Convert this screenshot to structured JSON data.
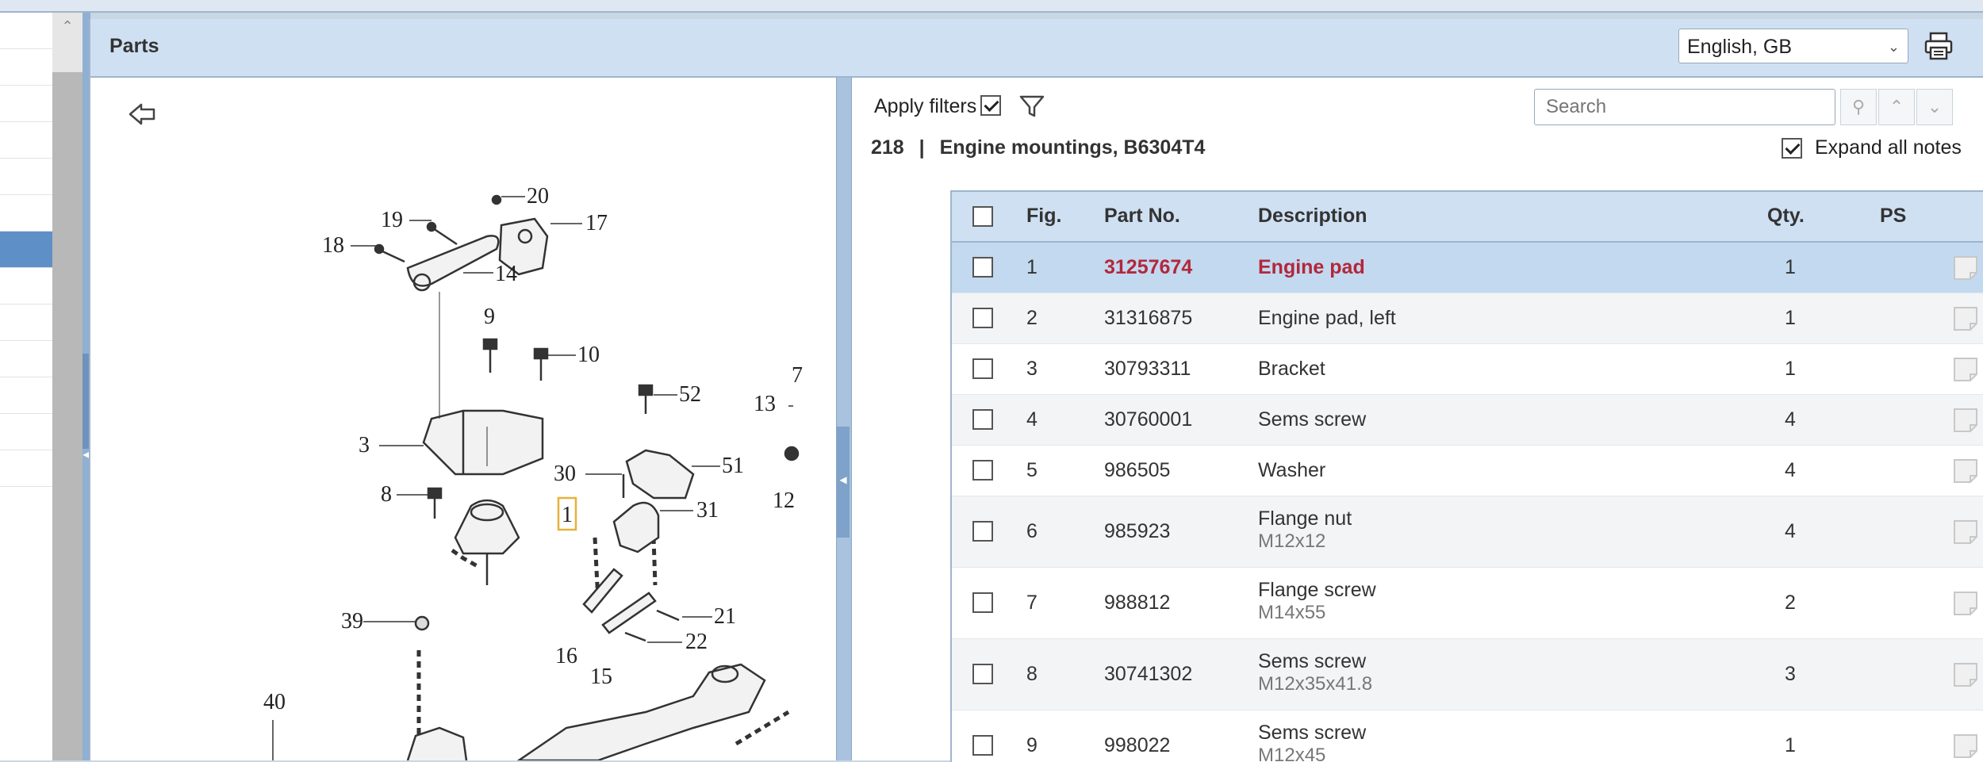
{
  "app": {
    "panel_title": "Parts",
    "language": "English, GB"
  },
  "illustration": {
    "callouts": [
      "20",
      "17",
      "19",
      "18",
      "14",
      "9",
      "10",
      "52",
      "13",
      "3",
      "51",
      "30",
      "8",
      "1",
      "31",
      "12",
      "39",
      "16",
      "15",
      "21",
      "22",
      "40",
      "7"
    ]
  },
  "filters": {
    "apply_label": "Apply filters",
    "apply_checked": true,
    "search_placeholder": "Search",
    "expand_label": "Expand all notes",
    "expand_checked": true
  },
  "breadcrumb": {
    "group": "218",
    "separator": "|",
    "title": "Engine mountings, B6304T4"
  },
  "table": {
    "columns": {
      "fig": "Fig.",
      "part_no": "Part No.",
      "description": "Description",
      "qty": "Qty.",
      "ps": "PS"
    },
    "rows": [
      {
        "fig": "1",
        "part_no": "31257674",
        "description": "Engine pad",
        "sub": "",
        "qty": "1",
        "selected": true
      },
      {
        "fig": "2",
        "part_no": "31316875",
        "description": "Engine pad, left",
        "sub": "",
        "qty": "1"
      },
      {
        "fig": "3",
        "part_no": "30793311",
        "description": "Bracket",
        "sub": "",
        "qty": "1"
      },
      {
        "fig": "4",
        "part_no": "30760001",
        "description": "Sems screw",
        "sub": "",
        "qty": "4"
      },
      {
        "fig": "5",
        "part_no": "986505",
        "description": "Washer",
        "sub": "",
        "qty": "4"
      },
      {
        "fig": "6",
        "part_no": "985923",
        "description": "Flange nut",
        "sub": "M12x12",
        "qty": "4"
      },
      {
        "fig": "7",
        "part_no": "988812",
        "description": "Flange screw",
        "sub": "M14x55",
        "qty": "2"
      },
      {
        "fig": "8",
        "part_no": "30741302",
        "description": "Sems screw",
        "sub": "M12x35x41.8",
        "qty": "3"
      },
      {
        "fig": "9",
        "part_no": "998022",
        "description": "Sems screw",
        "sub": "M12x45",
        "qty": "1"
      }
    ]
  }
}
